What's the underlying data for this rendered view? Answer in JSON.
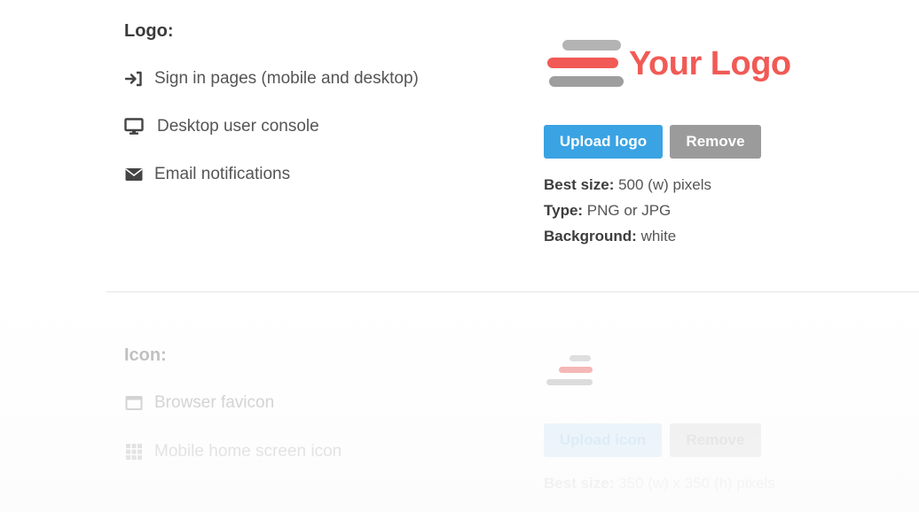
{
  "logo_section": {
    "title": "Logo:",
    "usages": [
      {
        "label": "Sign in pages (mobile and desktop)",
        "icon": "sign-in-icon"
      },
      {
        "label": "Desktop user console",
        "icon": "monitor-icon"
      },
      {
        "label": "Email notifications",
        "icon": "envelope-icon"
      }
    ],
    "preview_text": "Your Logo",
    "upload_label": "Upload logo",
    "remove_label": "Remove",
    "specs": [
      {
        "key": "Best size:",
        "value": " 500 (w) pixels"
      },
      {
        "key": "Type:",
        "value": " PNG or JPG"
      },
      {
        "key": "Background:",
        "value": " white"
      }
    ]
  },
  "icon_section": {
    "title": "Icon:",
    "usages": [
      {
        "label": "Browser favicon",
        "icon": "browser-window-icon"
      },
      {
        "label": "Mobile home screen icon",
        "icon": "app-grid-icon"
      }
    ],
    "upload_label": "Upload icon",
    "remove_label": "Remove",
    "specs": [
      {
        "key": "Best size:",
        "value": " 350 (w) x 350 (h) pixels"
      }
    ]
  },
  "colors": {
    "accent_blue": "#3aa3e3",
    "remove_gray": "#9b9b9b",
    "logo_red": "#f15a55",
    "logo_gray": "#9e9e9e"
  }
}
